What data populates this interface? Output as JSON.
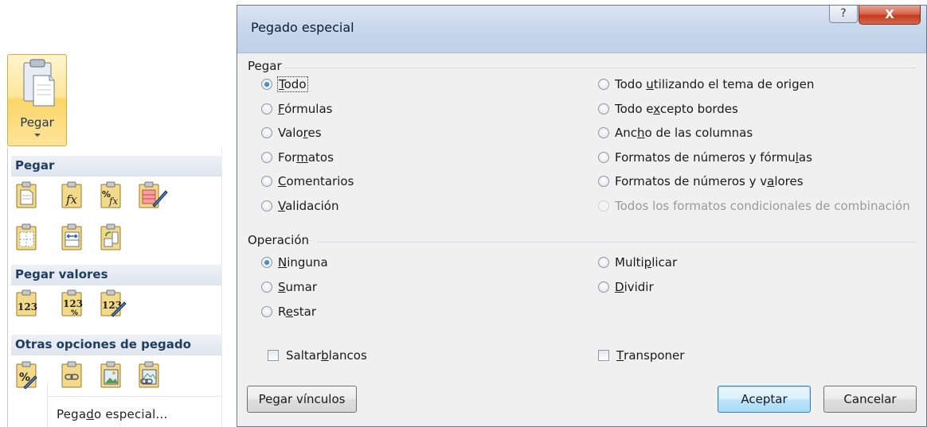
{
  "ribbon": {
    "pegar_label": "Pegar"
  },
  "paste_menu": {
    "sections": {
      "pegar": "Pegar",
      "pegar_valores": "Pegar valores",
      "otras_opciones": "Otras opciones de pegado"
    },
    "special_item": {
      "pre": "Pega",
      "u": "d",
      "post": "o especial..."
    }
  },
  "dialog": {
    "title": "Pegado especial",
    "help_label": "?",
    "close_label": "X",
    "groups": {
      "pegar": "Pegar",
      "operacion": "Operación"
    },
    "paste_options_left": [
      {
        "pre": "",
        "u": "T",
        "post": "odo",
        "checked": true
      },
      {
        "pre": "",
        "u": "F",
        "post": "órmulas",
        "checked": false
      },
      {
        "pre": "Valo",
        "u": "r",
        "post": "es",
        "checked": false
      },
      {
        "pre": "For",
        "u": "m",
        "post": "atos",
        "checked": false
      },
      {
        "pre": "",
        "u": "C",
        "post": "omentarios",
        "checked": false
      },
      {
        "pre": "",
        "u": "V",
        "post": "alidación",
        "checked": false
      }
    ],
    "paste_options_right": [
      {
        "pre": "Todo ",
        "u": "u",
        "post": "tilizando el tema de origen",
        "checked": false,
        "disabled": false
      },
      {
        "pre": "Todo e",
        "u": "x",
        "post": "cepto bordes",
        "checked": false,
        "disabled": false
      },
      {
        "pre": "Anc",
        "u": "h",
        "post": "o de las columnas",
        "checked": false,
        "disabled": false
      },
      {
        "pre": "Formatos de números y fórmu",
        "u": "l",
        "post": "as",
        "checked": false,
        "disabled": false
      },
      {
        "pre": "Formatos de números y v",
        "u": "a",
        "post": "lores",
        "checked": false,
        "disabled": false
      },
      {
        "pre": "Todos los formatos condicionales de combinación",
        "u": "",
        "post": "",
        "checked": false,
        "disabled": true
      }
    ],
    "operation_left": [
      {
        "pre": "",
        "u": "N",
        "post": "inguna",
        "checked": true
      },
      {
        "pre": "",
        "u": "S",
        "post": "umar",
        "checked": false
      },
      {
        "pre": "R",
        "u": "e",
        "post": "star",
        "checked": false
      }
    ],
    "operation_right": [
      {
        "pre": "Multi",
        "u": "p",
        "post": "licar",
        "checked": false
      },
      {
        "pre": "",
        "u": "D",
        "post": "ividir",
        "checked": false
      }
    ],
    "skip_blanks": {
      "pre": "Saltar ",
      "u": "b",
      "post": "lancos"
    },
    "transpose": {
      "pre": "",
      "u": "T",
      "post": "ransponer"
    },
    "paste_links": {
      "pre": "Pe",
      "u": "g",
      "post": "ar vínculos"
    },
    "accept_label": "Aceptar",
    "cancel_label": "Cancelar"
  }
}
